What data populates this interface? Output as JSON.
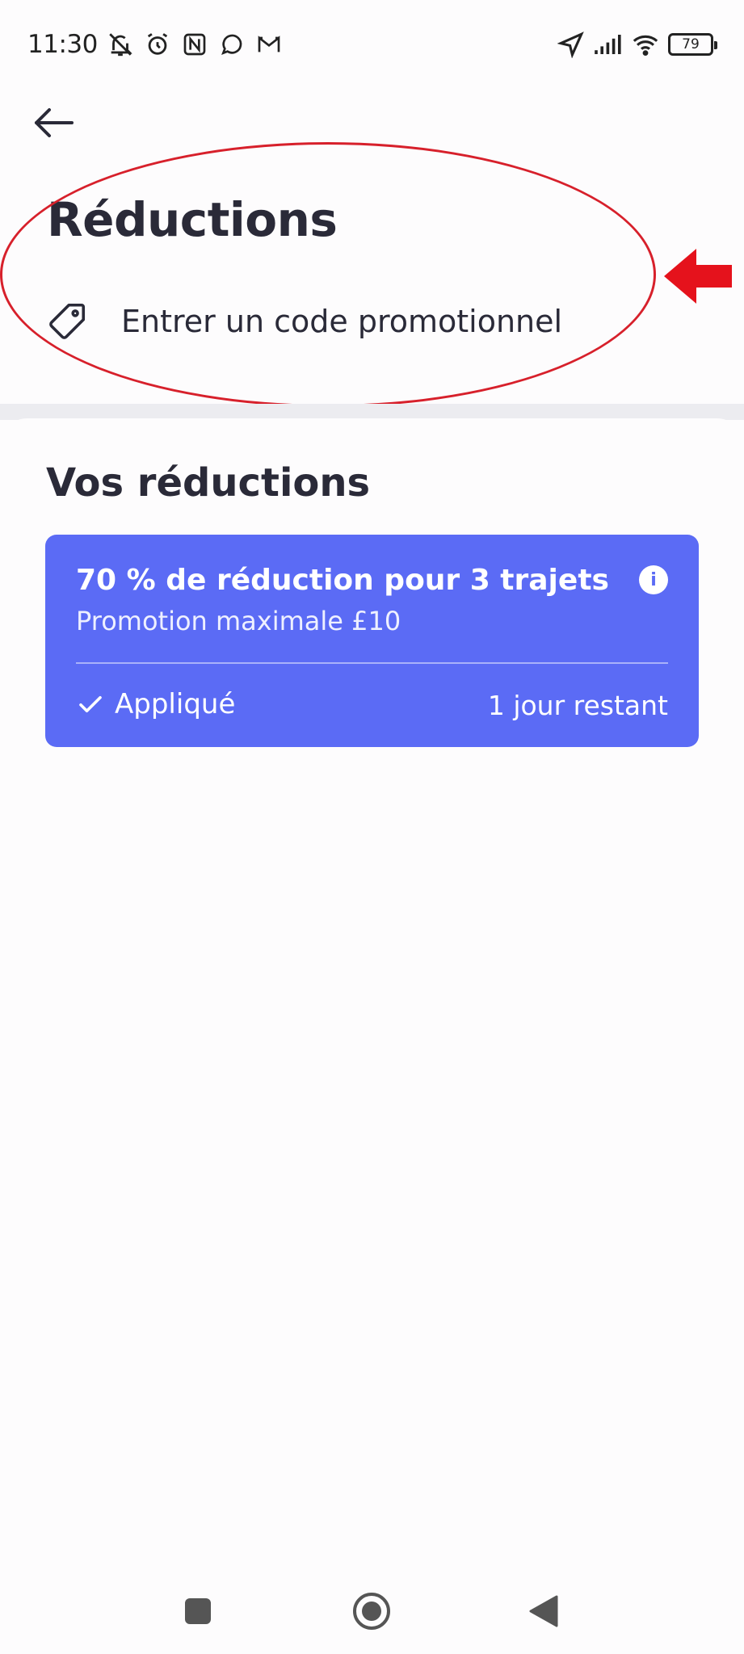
{
  "status_bar": {
    "time": "11:30",
    "battery": "79",
    "icons_left": [
      "muted-icon",
      "alarm-icon",
      "nfc-icon",
      "whatsapp-icon",
      "gmail-icon"
    ],
    "icons_right": [
      "location-icon",
      "signal-icon",
      "wifi-icon",
      "battery-icon"
    ]
  },
  "header": {
    "back_icon": "arrow-left-icon",
    "title": "Réductions",
    "promo_code_label": "Entrer un code promotionnel",
    "promo_icon": "tag-icon"
  },
  "discounts": {
    "section_title": "Vos réductions",
    "items": [
      {
        "title": "70 % de réduction pour 3 trajets",
        "subtitle": "Promotion maximale £10",
        "status": "Appliqué",
        "remaining": "1 jour restant",
        "card_color": "#5b6bf5"
      }
    ]
  },
  "annotation": {
    "color": "#d7202b",
    "shapes": [
      "ellipse",
      "arrow-left"
    ]
  },
  "nav_bar": {
    "buttons": [
      "recents-icon",
      "home-icon",
      "back-icon"
    ]
  }
}
